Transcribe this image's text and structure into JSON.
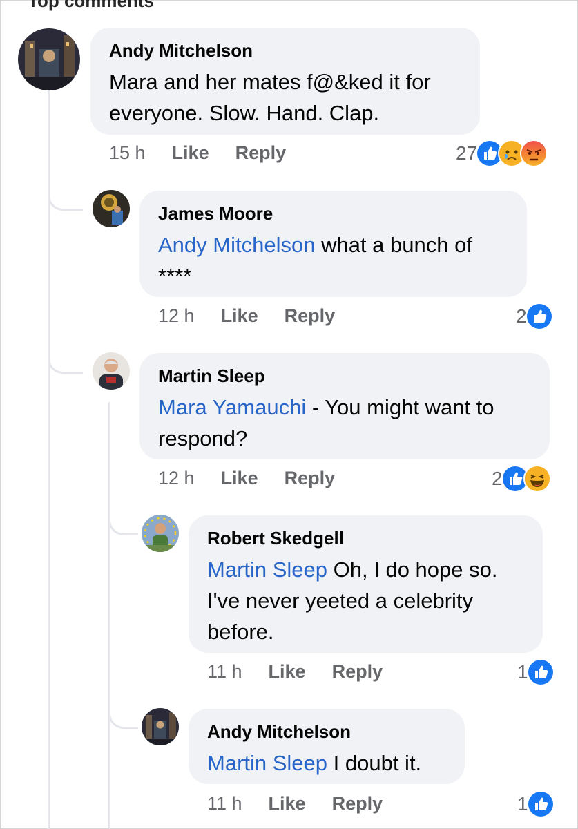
{
  "top_cut_text": "Top comments",
  "comments": [
    {
      "author": "Andy Mitchelson",
      "text": "Mara and her mates f@&ked it for everyone. Slow. Hand. Clap.",
      "time": "15 h",
      "like": "Like",
      "reply": "Reply",
      "reaction_count": "27",
      "reactions": [
        "like-icon",
        "sad-icon",
        "angry-icon"
      ]
    },
    {
      "author": "James Moore",
      "mention": "Andy Mitchelson",
      "text": " what a bunch of ****",
      "time": "12 h",
      "like": "Like",
      "reply": "Reply",
      "reaction_count": "2",
      "reactions": [
        "like-icon"
      ]
    },
    {
      "author": "Martin Sleep",
      "mention": "Mara Yamauchi",
      "text": " - You might want to respond?",
      "time": "12 h",
      "like": "Like",
      "reply": "Reply",
      "reaction_count": "2",
      "reactions": [
        "like-icon",
        "haha-icon"
      ]
    },
    {
      "author": "Robert Skedgell",
      "mention": "Martin Sleep",
      "text": " Oh, I do hope so. I've never yeeted a celebrity before.",
      "time": "11 h",
      "like": "Like",
      "reply": "Reply",
      "reaction_count": "1",
      "reactions": [
        "like-icon"
      ]
    },
    {
      "author": "Andy Mitchelson",
      "mention": "Martin Sleep",
      "text": " I doubt it.",
      "time": "11 h",
      "like": "Like",
      "reply": "Reply",
      "reaction_count": "1",
      "reactions": [
        "like-icon"
      ]
    }
  ],
  "colors": {
    "mention": "#2765c9",
    "like_blue": "#1877f2",
    "bubble": "#f0f2f5",
    "meta": "#65676b"
  }
}
